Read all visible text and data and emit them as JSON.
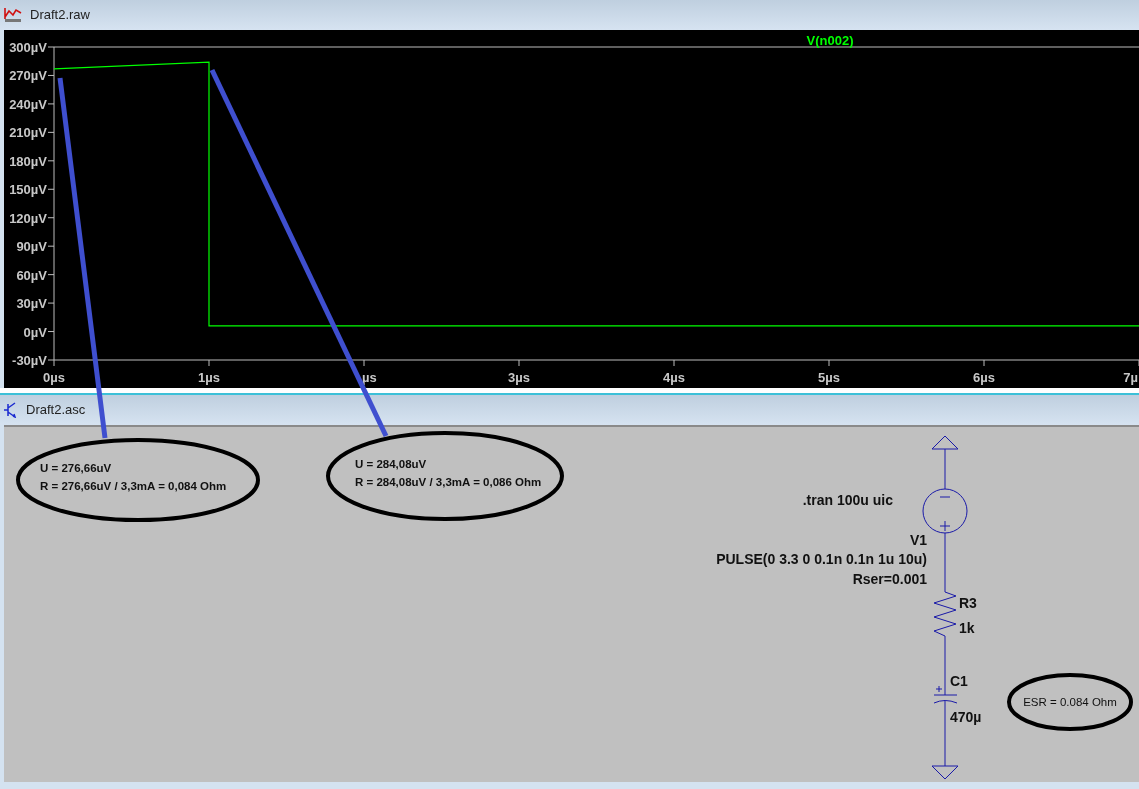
{
  "plot_window": {
    "title": "Draft2.raw",
    "chart_data": {
      "type": "line",
      "x": [
        0,
        1,
        1,
        7
      ],
      "series": [
        {
          "name": "V(n002)",
          "color": "#00ff00",
          "values": [
            277,
            284,
            6,
            6
          ]
        }
      ],
      "xlim": [
        0,
        7
      ],
      "ylim": [
        -30,
        300
      ],
      "xticks": [
        {
          "value": 0,
          "label": "0µs"
        },
        {
          "value": 1,
          "label": "1µs"
        },
        {
          "value": 2,
          "label": "µs"
        },
        {
          "value": 3,
          "label": "3µs"
        },
        {
          "value": 4,
          "label": "4µs"
        },
        {
          "value": 5,
          "label": "5µs"
        },
        {
          "value": 6,
          "label": "6µs"
        },
        {
          "value": 7,
          "label": "7µ"
        }
      ],
      "yticks": [
        {
          "value": 300,
          "label": "300µV"
        },
        {
          "value": 270,
          "label": "270µV"
        },
        {
          "value": 240,
          "label": "240µV"
        },
        {
          "value": 210,
          "label": "210µV"
        },
        {
          "value": 180,
          "label": "180µV"
        },
        {
          "value": 150,
          "label": "150µV"
        },
        {
          "value": 120,
          "label": "120µV"
        },
        {
          "value": 90,
          "label": "90µV"
        },
        {
          "value": 60,
          "label": "60µV"
        },
        {
          "value": 30,
          "label": "30µV"
        },
        {
          "value": 0,
          "label": "0µV"
        },
        {
          "value": -30,
          "label": "-30µV"
        }
      ]
    }
  },
  "schematic_window": {
    "title": "Draft2.asc",
    "directive": ".tran 100u uic",
    "source": {
      "name": "V1",
      "value": "PULSE(0 3.3 0 0.1n 0.1n 1u 10u)",
      "series_resistance": "Rser=0.001"
    },
    "resistor": {
      "name": "R3",
      "value": "1k"
    },
    "capacitor": {
      "name": "C1",
      "value": "470µ"
    }
  },
  "annotations": [
    {
      "lines": [
        "U = 276,66uV",
        "R = 276,66uV / 3,3mA = 0,084 Ohm"
      ]
    },
    {
      "lines": [
        "U = 284,08uV",
        "R = 284,08uV / 3,3mA = 0,086 Ohm"
      ]
    },
    {
      "lines": [
        "ESR = 0.084 Ohm"
      ]
    }
  ]
}
